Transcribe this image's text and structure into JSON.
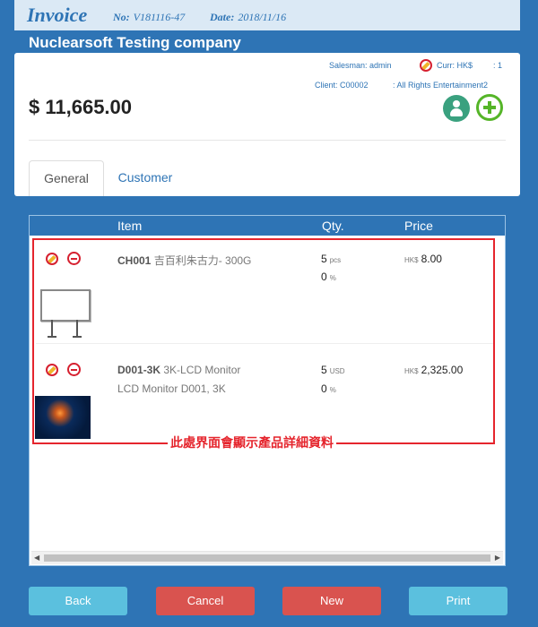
{
  "header": {
    "title": "Invoice",
    "no_label": "No:",
    "no_value": "V181116-47",
    "date_label": "Date:",
    "date_value": "2018/11/16",
    "company": "Nuclearsoft Testing company"
  },
  "summary": {
    "salesman": "Salesman: admin",
    "currency": "Curr: HK$",
    "rate": ": 1",
    "client": "Client: C00002",
    "client_name": ": All Rights Entertainment2",
    "total": "$ 11,665.00"
  },
  "tabs": [
    {
      "label": "General",
      "active": true
    },
    {
      "label": "Customer",
      "active": false
    }
  ],
  "table": {
    "columns": [
      "Item",
      "Qty.",
      "Price"
    ],
    "rows": [
      {
        "code": "CH001",
        "description": "吉百利朱古力- 300G",
        "description2": "",
        "qty": "5",
        "unit": "pcs",
        "discount": "0",
        "discount_unit": "%",
        "currency": "HK$",
        "price": "8.00",
        "image": "whiteboard"
      },
      {
        "code": "D001-3K",
        "description": "3K-LCD Monitor",
        "description2": "LCD Monitor D001, 3K",
        "qty": "5",
        "unit": "USD",
        "discount": "0",
        "discount_unit": "%",
        "currency": "HK$",
        "price": "2,325.00",
        "image": "jellyfish"
      }
    ],
    "annotation": "此處界面會顯示產品詳細資料"
  },
  "buttons": {
    "back": "Back",
    "cancel": "Cancel",
    "new": "New",
    "print": "Print"
  },
  "colors": {
    "background": "#2e74b5",
    "header_bar": "#dbe9f5",
    "highlight": "#e5252d",
    "info_button": "#5bc0de",
    "danger_button": "#d9534f",
    "add_icon": "#55b528"
  }
}
